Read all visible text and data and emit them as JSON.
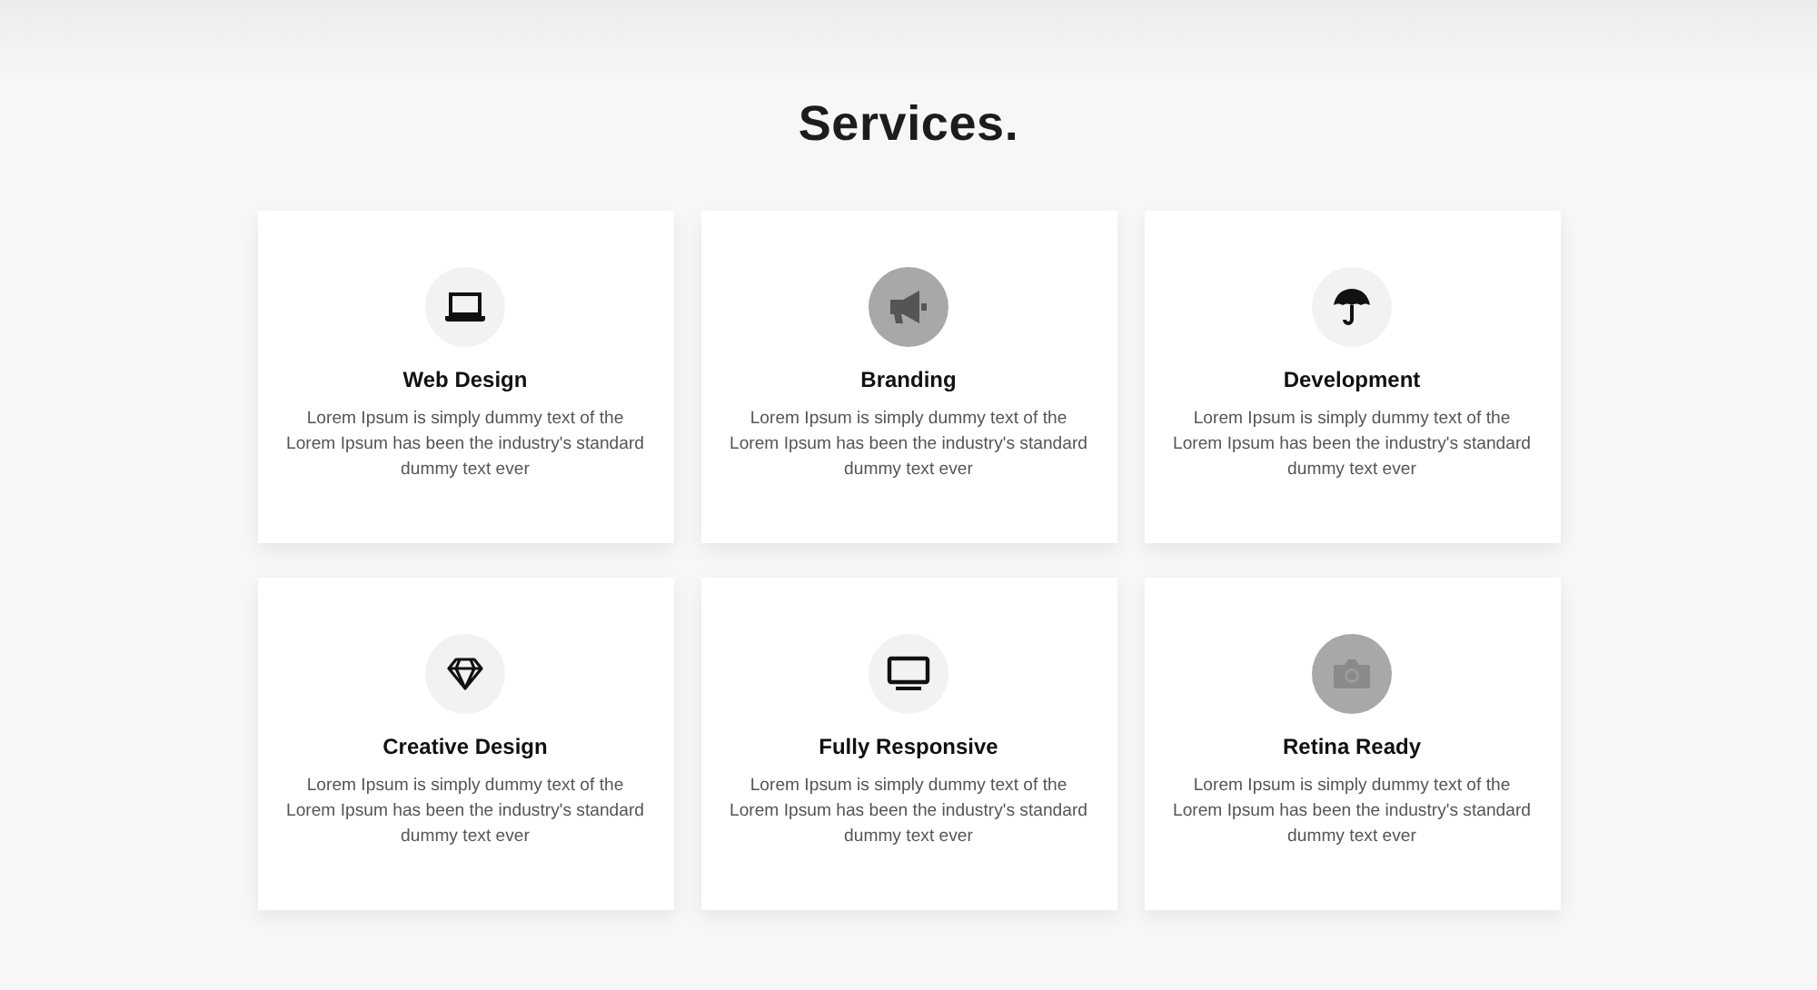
{
  "heading": "Services.",
  "services": [
    {
      "kind": "laptop",
      "title": "Web Design",
      "text": "Lorem Ipsum is simply dummy text of the Lorem Ipsum has been the industry's standard dummy text ever",
      "highlighted": false
    },
    {
      "kind": "megaphone",
      "title": "Branding",
      "text": "Lorem Ipsum is simply dummy text of the Lorem Ipsum has been the industry's standard dummy text ever",
      "highlighted": true
    },
    {
      "kind": "umbrella",
      "title": "Development",
      "text": "Lorem Ipsum is simply dummy text of the Lorem Ipsum has been the industry's standard dummy text ever",
      "highlighted": false
    },
    {
      "kind": "diamond",
      "title": "Creative Design",
      "text": "Lorem Ipsum is simply dummy text of the Lorem Ipsum has been the industry's standard dummy text ever",
      "highlighted": false
    },
    {
      "kind": "monitor",
      "title": "Fully Responsive",
      "text": "Lorem Ipsum is simply dummy text of the Lorem Ipsum has been the industry's standard dummy text ever",
      "highlighted": false
    },
    {
      "kind": "camera",
      "title": "Retina Ready",
      "text": "Lorem Ipsum is simply dummy text of the Lorem Ipsum has been the industry's standard dummy text ever",
      "highlighted": true
    }
  ]
}
